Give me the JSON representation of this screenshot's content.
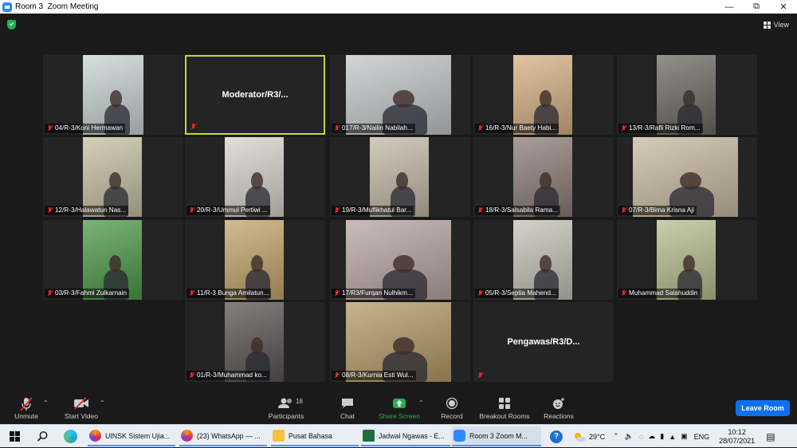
{
  "window": {
    "title": "Room 3  Zoom Meeting",
    "controls": [
      "minimize",
      "maximize",
      "close"
    ]
  },
  "view_button": {
    "label": "View"
  },
  "tiles": [
    {
      "name": "04/R-3/Koni Hermawan",
      "muted": true,
      "bg": "#c9d3d3"
    },
    {
      "name": "Moderator/R3/...",
      "muted": true,
      "video": false,
      "active": true
    },
    {
      "name": "017/R-3/Nailin Nabilah...",
      "muted": true,
      "bg": "#c2c7c8"
    },
    {
      "name": "16/R-3/Nur Baety Habi...",
      "muted": true,
      "bg": "#d7b184"
    },
    {
      "name": "13/R-3/Rafli Rizki Rom...",
      "muted": true,
      "bg": "#6d6a63"
    },
    {
      "name": "12/R-3/Halawatun Nas...",
      "muted": true,
      "bg": "#c7c0a3"
    },
    {
      "name": "20/R-3/Ummul Pertiwi ...",
      "muted": true,
      "bg": "#d8d4ce"
    },
    {
      "name": "19/R-3/Muflikhatul Bar...",
      "muted": true,
      "bg": "#c4b9a6"
    },
    {
      "name": "18/R-3/Salsabila Rama...",
      "muted": true,
      "bg": "#8c7d78"
    },
    {
      "name": "07/R-3/Bima Krisna Aji",
      "muted": true,
      "bg": "#c9b9a1"
    },
    {
      "name": "03/R-3/Fahmi Zulkarnain",
      "muted": true,
      "bg": "#4d9a48"
    },
    {
      "name": "11/R-3 Bunga Amilatun...",
      "muted": true,
      "bg": "#c3a56b"
    },
    {
      "name": "17/R3/Furqan Nulhikm...",
      "muted": true,
      "bg": "#b9a6a2"
    },
    {
      "name": "05/R-3/Septia Mahend...",
      "muted": true,
      "bg": "#c3c3b7"
    },
    {
      "name": "Muhammad Salahuddin",
      "muted": true,
      "bg": "#b8bf8e"
    },
    {
      "name": "01/R-3/Muhammad ko...",
      "muted": true,
      "bg": "#5a5555"
    },
    {
      "name": "08/R-3/Kurnia Esti Wul...",
      "muted": true,
      "bg": "#b59a68"
    },
    {
      "name": "Pengawas/R3/D...",
      "muted": true,
      "video": false
    }
  ],
  "toolbar": {
    "unmute": "Unmute",
    "start_video": "Start Video",
    "participants": "Participants",
    "participants_count": "18",
    "chat": "Chat",
    "share_screen": "Share Screen",
    "record": "Record",
    "breakout_rooms": "Breakout Rooms",
    "reactions": "Reactions",
    "leave_room": "Leave Room"
  },
  "taskbar": {
    "apps": [
      {
        "label": "UINSK Sistem Ujia...",
        "icon": "firefox-icon"
      },
      {
        "label": "(23) WhatsApp — ...",
        "icon": "firefox-icon"
      },
      {
        "label": "Pusat Bahasa",
        "icon": "folder-icon"
      },
      {
        "label": "Jadwal Ngawas - E...",
        "icon": "excel-icon"
      },
      {
        "label": "Room 3   Zoom M...",
        "icon": "zoom-icon"
      }
    ],
    "weather": "29°C",
    "language": "ENG",
    "time": "10:12",
    "date": "28/07/2021"
  },
  "colors": {
    "accent": "#0e71eb",
    "active_speaker": "#c8d63a",
    "share_green": "#23b14d",
    "muted_red": "#e02828"
  }
}
